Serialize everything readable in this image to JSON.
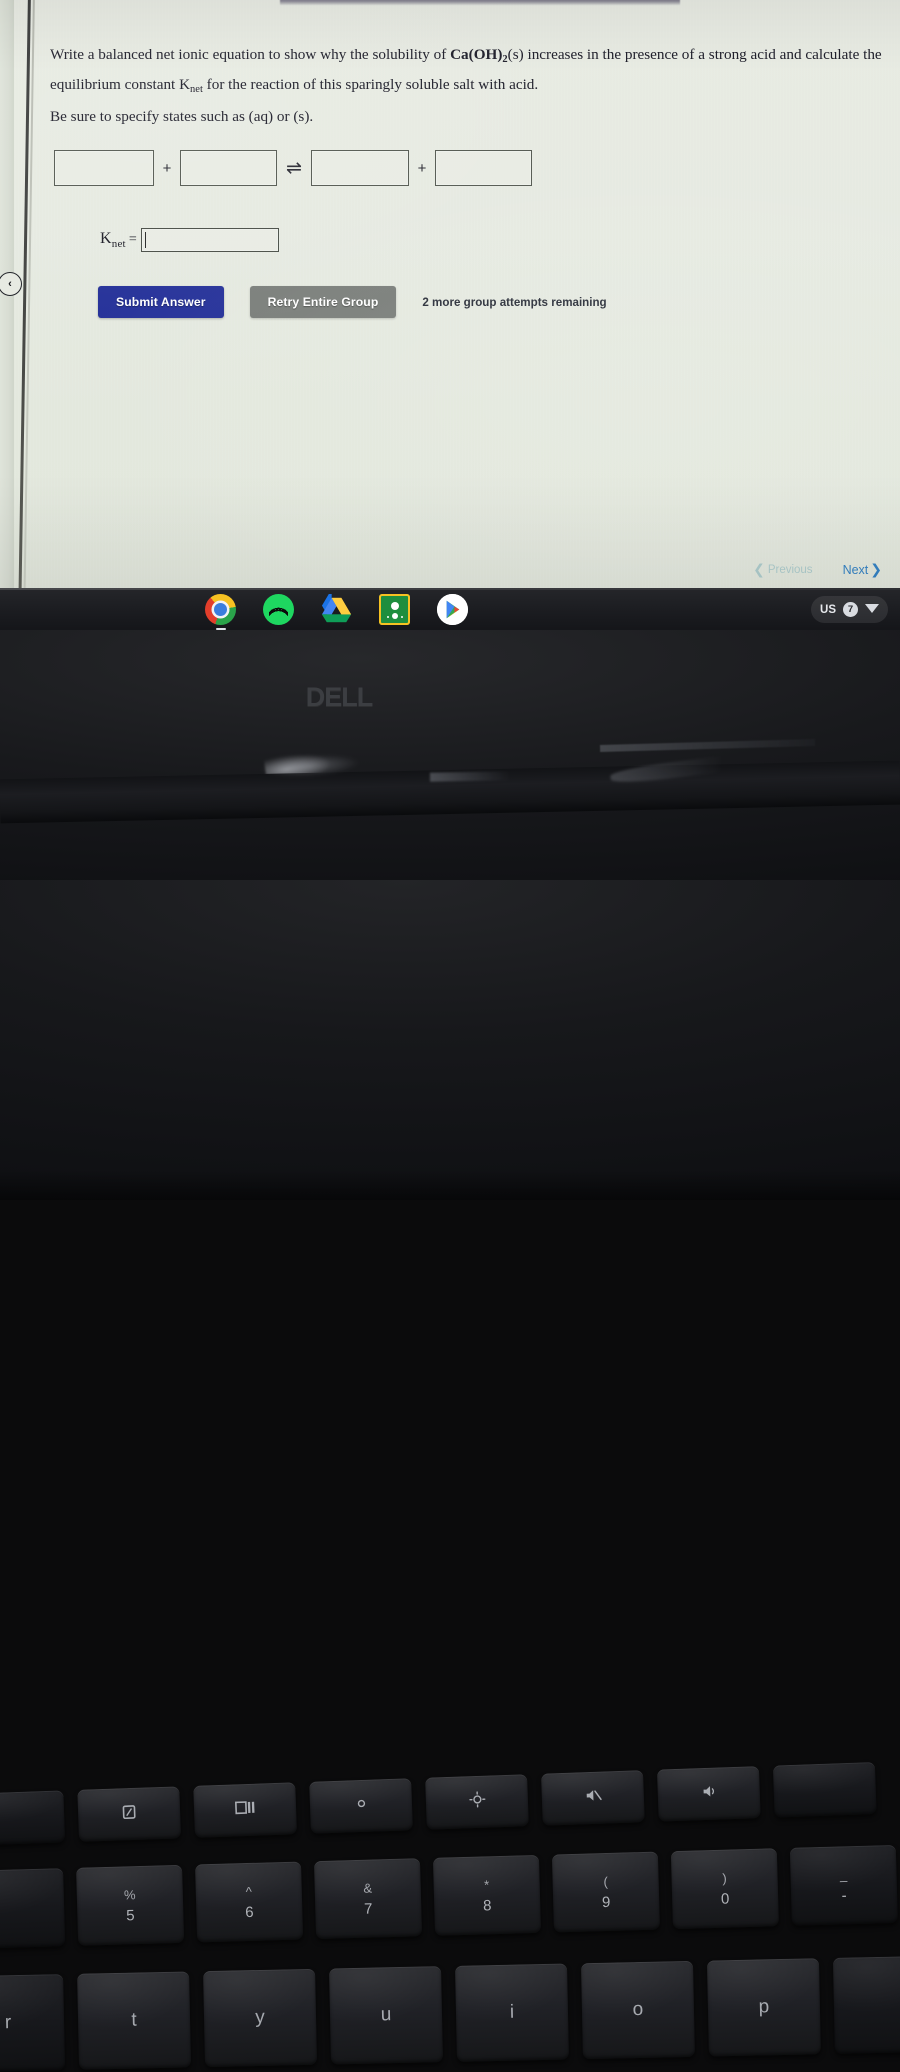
{
  "question": {
    "truncated_top_line": "",
    "prompt_part1": "Write a balanced net ionic equation to show why the solubility of ",
    "formula": "Ca(OH)",
    "formula_sub": "2",
    "formula_state": "(s)",
    "prompt_part2": " increases in the presence of a strong acid and calculate the equilibrium constant K",
    "knet_sub": "net",
    "prompt_part3": " for the reaction of this sparingly soluble salt with acid.",
    "states_note": "Be sure to specify states such as (aq) or (s)."
  },
  "equation": {
    "boxes": [
      {
        "value": "",
        "placeholder": ""
      },
      {
        "value": "",
        "placeholder": ""
      },
      {
        "value": "",
        "placeholder": ""
      },
      {
        "value": "",
        "placeholder": ""
      }
    ],
    "plus_1": "+",
    "plus_2": "+",
    "arrow": "⇌"
  },
  "knet": {
    "label": "K",
    "subscript": "net",
    "equals": "=",
    "value": "",
    "placeholder": ""
  },
  "actions": {
    "submit_label": "Submit Answer",
    "retry_label": "Retry Entire Group",
    "attempts_text": "2 more group attempts remaining",
    "submit_color": "#27339a",
    "retry_color": "#7b7f7b"
  },
  "sidebar": {
    "collapse_icon": "chevron-left-icon",
    "collapse_glyph": "‹"
  },
  "pager": {
    "previous_label": "Previous",
    "next_label": "Next",
    "prev_chevron": "❮",
    "next_chevron": "❯"
  },
  "shelf": {
    "apps": [
      {
        "name": "chrome",
        "label": "Chrome"
      },
      {
        "name": "spotify",
        "label": "Spotify"
      },
      {
        "name": "drive",
        "label": "Google Drive"
      },
      {
        "name": "classroom",
        "label": "Google Classroom"
      },
      {
        "name": "play-store",
        "label": "Play Store"
      }
    ],
    "status": {
      "keyboard_layout": "US",
      "badge": "7",
      "wifi_icon": "wifi-icon"
    }
  },
  "laptop": {
    "brand": "D∂LL",
    "brand_plain": "DELL"
  },
  "keyboard": {
    "function_row": [
      {
        "name": "fullscreen-key",
        "icon": "fullscreen-icon"
      },
      {
        "name": "overview-key",
        "icon": "window-overview-icon"
      },
      {
        "name": "brightness-down-key",
        "icon": "brightness-down-icon"
      },
      {
        "name": "brightness-up-key",
        "icon": "brightness-up-icon"
      },
      {
        "name": "mute-key",
        "icon": "volume-mute-icon"
      },
      {
        "name": "volume-down-key",
        "icon": "volume-icon"
      },
      {
        "name": "volume-up-key",
        "icon": "volume-up-icon"
      }
    ],
    "number_row": [
      {
        "top": "%",
        "bottom": "5"
      },
      {
        "top": "^",
        "bottom": "6"
      },
      {
        "top": "&",
        "bottom": "7"
      },
      {
        "top": "*",
        "bottom": "8"
      },
      {
        "top": "(",
        "bottom": "9"
      },
      {
        "top": ")",
        "bottom": "0"
      },
      {
        "top": "_",
        "bottom": "-"
      }
    ],
    "letter_row": [
      {
        "letter": "r"
      },
      {
        "letter": "t"
      },
      {
        "letter": "y"
      },
      {
        "letter": "u"
      },
      {
        "letter": "i"
      },
      {
        "letter": "o"
      },
      {
        "letter": "p"
      }
    ]
  }
}
